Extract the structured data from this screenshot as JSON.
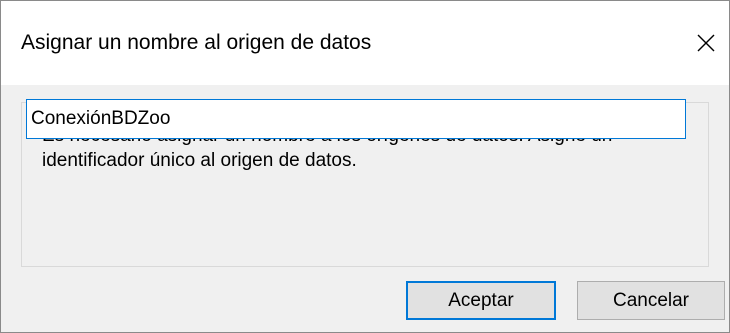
{
  "window": {
    "title": "Asignar un nombre al origen de datos",
    "close_icon": "close-icon"
  },
  "content": {
    "message": "Es necesario asignar un nombre a los orígenes de datos. Asigne un identificador único al origen de datos.",
    "name_input_value": "ConexiónBDZoo"
  },
  "buttons": {
    "ok_label": "Aceptar",
    "cancel_label": "Cancelar"
  },
  "colors": {
    "accent": "#0078d7",
    "dialog_background": "#f0f0f0",
    "button_background": "#e1e1e1"
  }
}
